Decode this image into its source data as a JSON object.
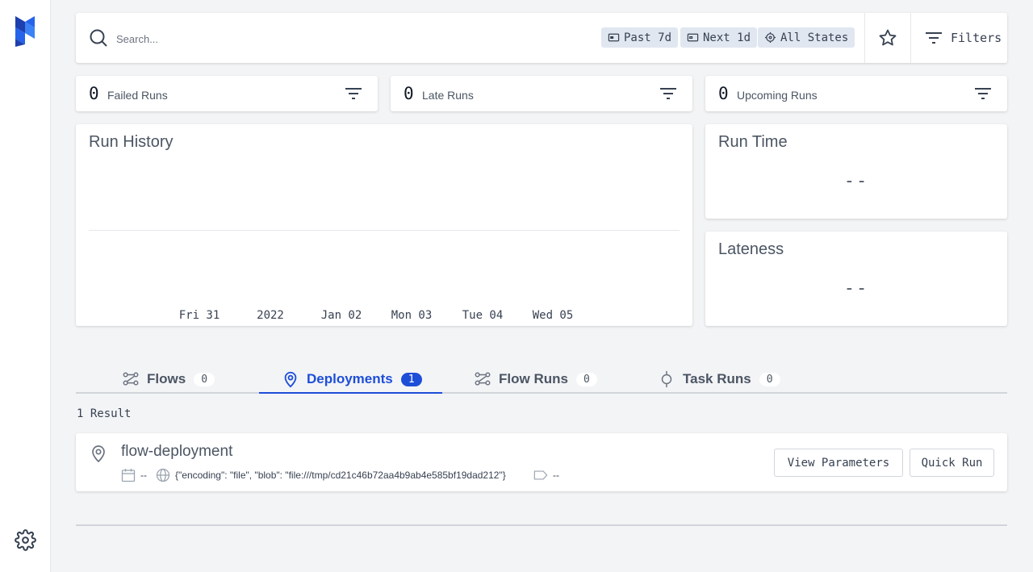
{
  "search": {
    "placeholder": "Search..."
  },
  "chips": {
    "past": "Past 7d",
    "next": "Next 1d",
    "states": "All States"
  },
  "filters_label": "Filters",
  "stats": [
    {
      "count": "0",
      "label": "Failed Runs"
    },
    {
      "count": "0",
      "label": "Late Runs"
    },
    {
      "count": "0",
      "label": "Upcoming Runs"
    }
  ],
  "run_history": {
    "title": "Run History",
    "ticks": [
      "Fri 31",
      "2022",
      "Jan 02",
      "Mon 03",
      "Tue 04",
      "Wed 05"
    ]
  },
  "run_time": {
    "title": "Run Time",
    "value": "--"
  },
  "lateness": {
    "title": "Lateness",
    "value": "--"
  },
  "tabs": [
    {
      "label": "Flows",
      "count": "0",
      "icon": "flow-icon"
    },
    {
      "label": "Deployments",
      "count": "1",
      "icon": "location-pin-icon",
      "active": true
    },
    {
      "label": "Flow Runs",
      "count": "0",
      "icon": "flow-run-icon"
    },
    {
      "label": "Task Runs",
      "count": "0",
      "icon": "task-run-icon"
    }
  ],
  "result_count": "1 Result",
  "deployment": {
    "name": "flow-deployment",
    "schedule": "--",
    "location": "{\"encoding\": \"file\", \"blob\": \"file:///tmp/cd21c46b72aa4b9ab4e585bf19dad212\"}",
    "tags": "--",
    "view_parameters_label": "View Parameters",
    "quick_run_label": "Quick Run"
  },
  "colors": {
    "accent": "#1d4ed8",
    "background": "#f3f4f6",
    "chip": "#e0e7f1"
  }
}
